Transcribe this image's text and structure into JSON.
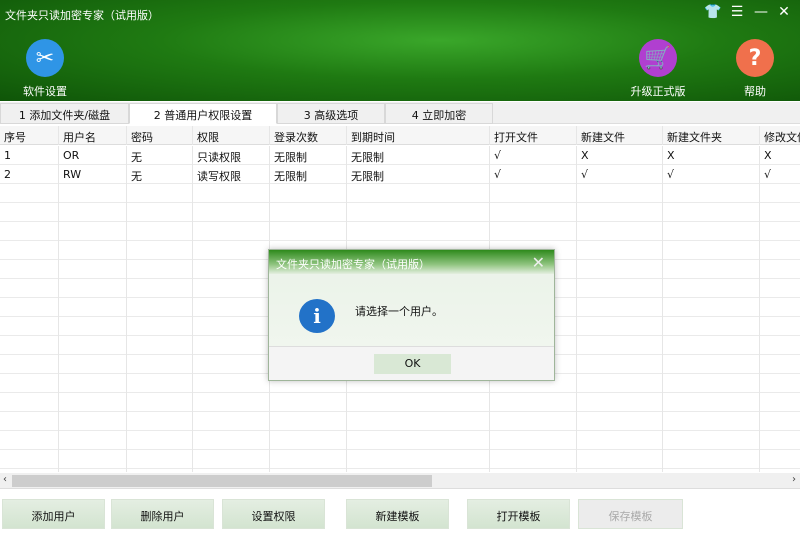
{
  "window": {
    "title": "文件夹只读加密专家（试用版）",
    "controls": [
      "skin",
      "menu",
      "minimize",
      "close"
    ]
  },
  "toolbar": {
    "settings": "软件设置",
    "upgrade": "升级正式版",
    "help": "帮助"
  },
  "tabs": [
    "1 添加文件夹/磁盘",
    "2 普通用户权限设置",
    "3 高级选项",
    "4 立即加密"
  ],
  "table": {
    "columns": [
      "序号",
      "用户名",
      "密码",
      "权限",
      "登录次数",
      "到期时间",
      "打开文件",
      "新建文件",
      "新建文件夹",
      "修改文件"
    ],
    "rows": [
      [
        "1",
        "OR",
        "无",
        "只读权限",
        "无限制",
        "无限制",
        "√",
        "X",
        "X",
        "X"
      ],
      [
        "2",
        "RW",
        "无",
        "读写权限",
        "无限制",
        "无限制",
        "√",
        "√",
        "√",
        "√"
      ]
    ]
  },
  "scrollbar": {
    "position": 0
  },
  "buttons": {
    "add_user": "添加用户",
    "delete_user": "删除用户",
    "set_perm": "设置权限",
    "new_tpl": "新建模板",
    "open_tpl": "打开模板",
    "save_tpl": "保存模板"
  },
  "dialog": {
    "title": "文件夹只读加密专家（试用版）",
    "message": "请选择一个用户。",
    "ok": "OK"
  }
}
